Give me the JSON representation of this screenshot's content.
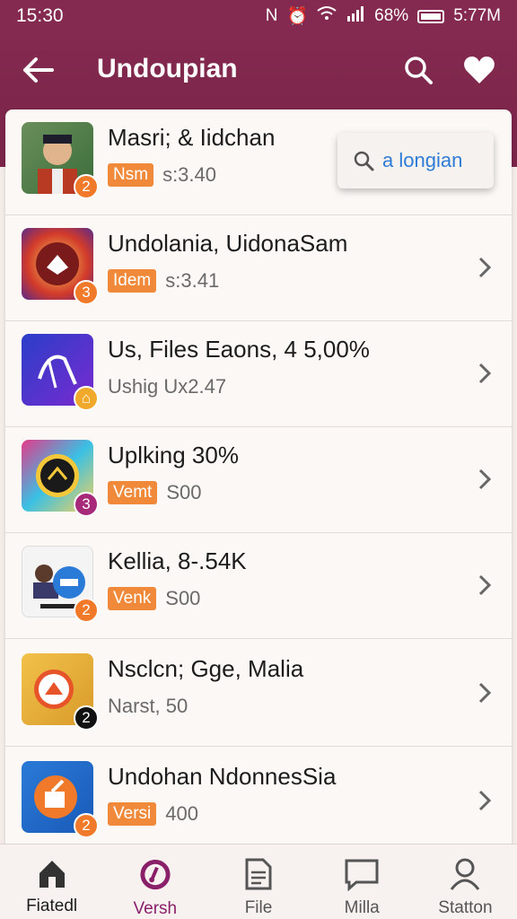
{
  "status": {
    "time": "15:30",
    "battery": "68%",
    "extra": "5:77M"
  },
  "appbar": {
    "title": "Undoupian"
  },
  "floating_search": {
    "text": "a longian"
  },
  "rows": [
    {
      "title": "Masri; & Iidchan",
      "tag": "Nsm",
      "meta": "s:3.40",
      "badge": "2",
      "badge_color": "#f07a2a"
    },
    {
      "title": "Undolania, UidonaSam",
      "tag": "Idem",
      "meta": "s:3.41",
      "badge": "3",
      "badge_color": "#f07a2a"
    },
    {
      "title": "Us, Files Eaons, 4 5,00%",
      "tag": "",
      "meta": "Ushig Ux2.47",
      "badge": "",
      "badge_color": "#f0a92a"
    },
    {
      "title": "Uplking 30%",
      "tag": "Vemt",
      "meta": "S00",
      "badge": "3",
      "badge_color": "#a6297a"
    },
    {
      "title": "Kellia, 8-.54K",
      "tag": "Venk",
      "meta": "S00",
      "badge": "2",
      "badge_color": "#f07a2a"
    },
    {
      "title": "Nsclcn; Gge, Malia",
      "tag": "",
      "meta": "Narst, 50",
      "badge": "2",
      "badge_color": "#111111"
    },
    {
      "title": "Undohan NdonnesSia",
      "tag": "Versi",
      "meta": "400",
      "badge": "2",
      "badge_color": "#f07a2a"
    }
  ],
  "nav": [
    {
      "label": "Fiatedl",
      "icon": "home-icon"
    },
    {
      "label": "Versh",
      "icon": "music-disc-icon"
    },
    {
      "label": "File",
      "icon": "file-icon"
    },
    {
      "label": "Milla",
      "icon": "chat-icon"
    },
    {
      "label": "Statton",
      "icon": "person-icon"
    }
  ],
  "colors": {
    "brand": "#84294f",
    "tag": "#f08a3a",
    "link": "#2e7cd6",
    "active_nav": "#8a1f6a"
  }
}
